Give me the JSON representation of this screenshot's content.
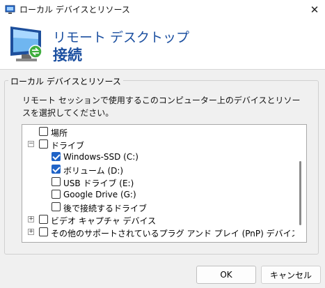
{
  "window": {
    "title": "ローカル デバイスとリソース",
    "close_label": "✕"
  },
  "banner": {
    "line1": "リモート デスクトップ",
    "line2": "接続"
  },
  "group": {
    "label": "ローカル デバイスとリソース",
    "description": "リモート セッションで使用するこのコンピューター上のデバイスとリソースを選択してください。"
  },
  "tree": {
    "items": [
      {
        "label": "場所",
        "checked": false,
        "expander": ""
      },
      {
        "label": "ドライブ",
        "checked": false,
        "expander": "−"
      },
      {
        "label": "Windows-SSD (C:)",
        "checked": true,
        "expander": ""
      },
      {
        "label": "ボリューム (D:)",
        "checked": true,
        "expander": ""
      },
      {
        "label": "USB ドライブ (E:)",
        "checked": false,
        "expander": ""
      },
      {
        "label": "Google Drive (G:)",
        "checked": false,
        "expander": ""
      },
      {
        "label": "後で接続するドライブ",
        "checked": false,
        "expander": ""
      },
      {
        "label": "ビデオ キャプチャ デバイス",
        "checked": false,
        "expander": "+"
      },
      {
        "label": "その他のサポートされているプラグ アンド プレイ (PnP) デバイス",
        "checked": false,
        "expander": "+"
      }
    ]
  },
  "buttons": {
    "ok": "OK",
    "cancel": "キャンセル"
  },
  "colors": {
    "banner_text": "#1b4fa0",
    "checkbox_checked": "#1f63c7"
  }
}
